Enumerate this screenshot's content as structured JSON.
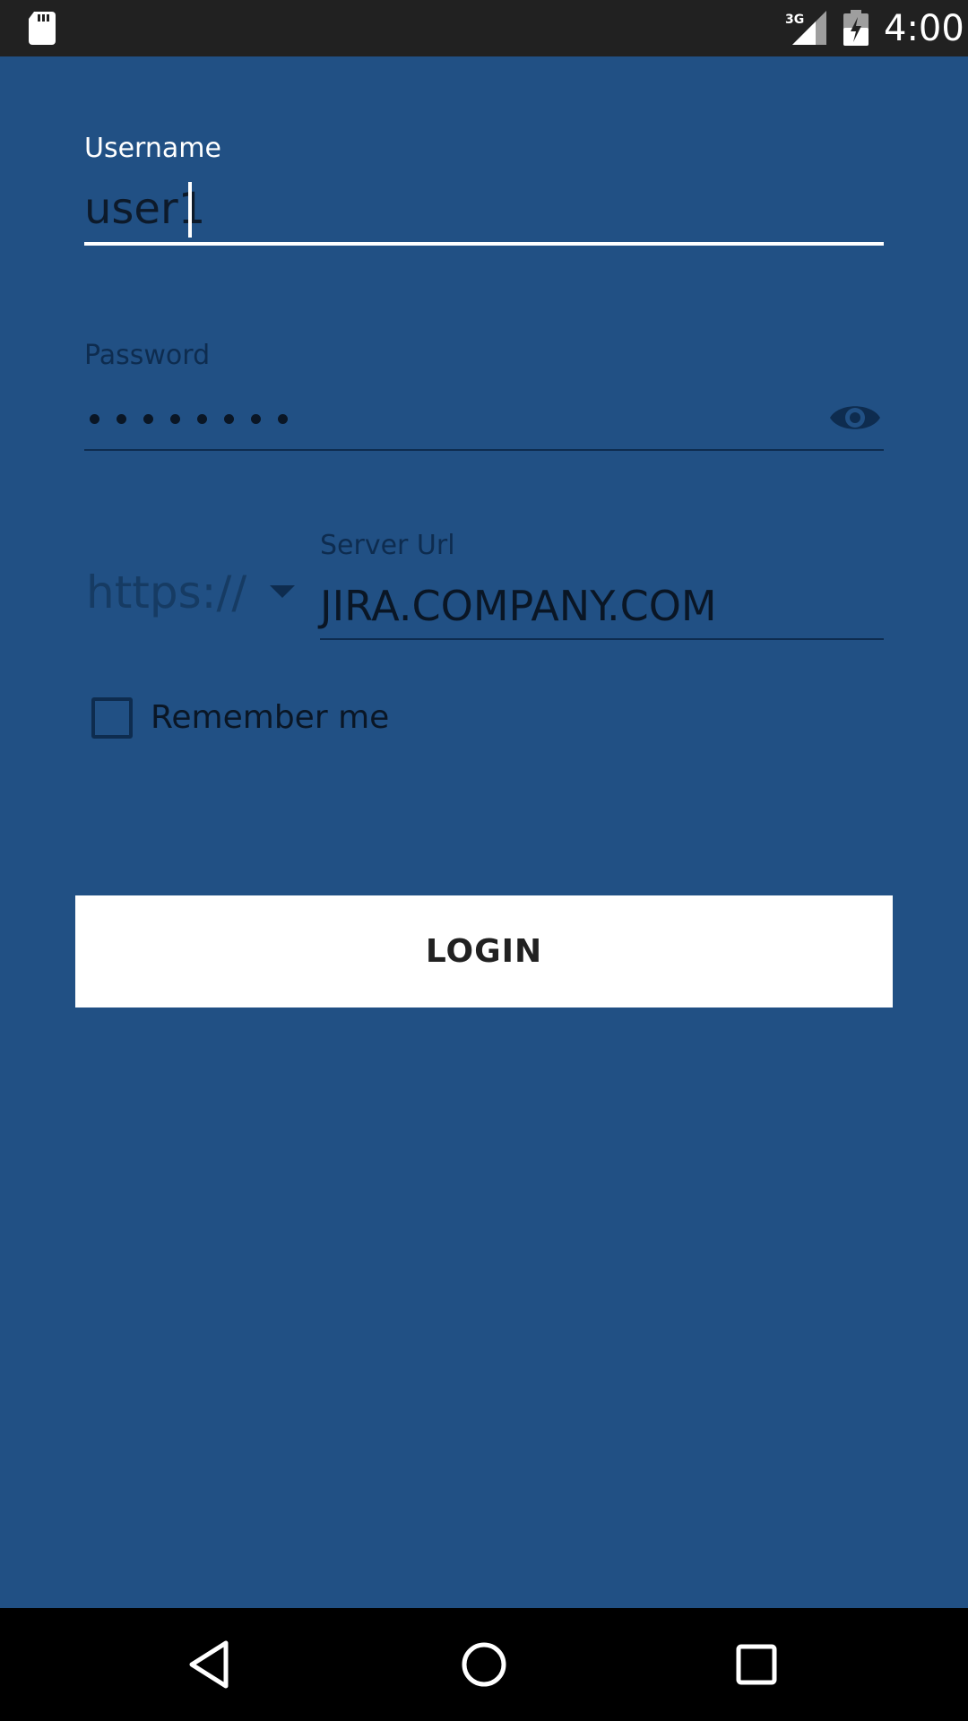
{
  "status_bar": {
    "network_type": "3G",
    "time": "4:00",
    "icons": [
      "sd-card-icon",
      "signal-icon",
      "battery-charging-icon"
    ]
  },
  "login_form": {
    "username": {
      "label": "Username",
      "value": "user1"
    },
    "password": {
      "label": "Password",
      "masked_length": 8,
      "toggle_icon": "eye-icon"
    },
    "protocol": {
      "selected": "https://"
    },
    "server_url": {
      "label": "Server Url",
      "value": "JIRA.COMPANY.COM"
    },
    "remember_me": {
      "label": "Remember me",
      "checked": false
    },
    "login_button": {
      "label": "LOGIN"
    }
  },
  "nav_bar": {
    "icons": [
      "back-icon",
      "home-icon",
      "recents-icon"
    ]
  },
  "colors": {
    "background": "#215084",
    "status_bar": "#212121",
    "nav_bar": "#000000",
    "accent": "#ffffff",
    "dark_text": "#0a1625"
  }
}
